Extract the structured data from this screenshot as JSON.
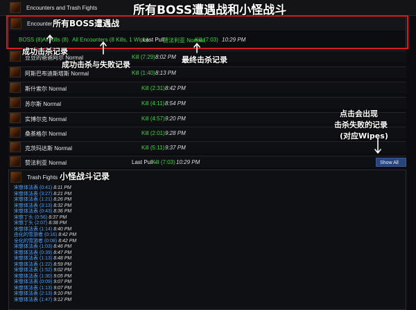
{
  "top": {
    "title": "Encounters and Trash Fights"
  },
  "encounters_panel": {
    "title": "Encounters",
    "filters": {
      "boss_count": "BOSS (8)",
      "all_kills": "All Kills (8)",
      "all_encounters": "All Encounters (8 Kills, 1 Wipe)",
      "last_pull_label": "Last Pull -",
      "last_pull_boss": "赞法利亚 Normal",
      "last_pull_kill": "Kill (7:03)",
      "last_pull_time": "10:29 PM"
    }
  },
  "boss_rows": [
    {
      "name": "豆豆的爸爸阿尔 Normal",
      "kill": "Kill (7:29)",
      "time": "8:02 PM"
    },
    {
      "name": "阿斯巴布迪斯塔斯 Normal",
      "kill": "Kill (1:40)",
      "time": "8:13 PM"
    },
    {
      "name": "斯什索尔 Normal",
      "kill": "Kill (2:31)",
      "time": "8:42 PM"
    },
    {
      "name": "苏尔斯 Normal",
      "kill": "Kill (4:11)",
      "time": "8:54 PM"
    },
    {
      "name": "实博尔克 Normal",
      "kill": "Kill (4:57)",
      "time": "9:20 PM"
    },
    {
      "name": "桑茶格尔 Normal",
      "kill": "Kill (2:01)",
      "time": "9:28 PM"
    },
    {
      "name": "克茨玛达斯 Normal",
      "kill": "Kill (5:11)",
      "time": "9:37 PM"
    },
    {
      "name": "赞法利亚 Normal",
      "last_pull": "Last Pull -",
      "kill": "Kill (7:03)",
      "time": "10:29 PM",
      "button": "Show All ▾"
    }
  ],
  "trash_panel": {
    "title": "Trash Fights",
    "lines": [
      {
        "name": "宋慈体法表 (0:41)",
        "time": "8:11 PM"
      },
      {
        "name": "宋慈体法表 (3:27)",
        "time": "8:21 PM"
      },
      {
        "name": "宋慈体法表 (1:21)",
        "time": "8:26 PM"
      },
      {
        "name": "宋慈体法表 (3:13)",
        "time": "8:32 PM"
      },
      {
        "name": "宋慈体法表 (0:43)",
        "time": "8:36 PM"
      },
      {
        "name": "宋慈丁头 (0:56)",
        "time": "8:37 PM"
      },
      {
        "name": "宋慈丁头 (2:07)",
        "time": "8:38 PM"
      },
      {
        "name": "宋慈体法表 (1:14)",
        "time": "8:40 PM"
      },
      {
        "name": "由化的雪游者 (0:16)",
        "time": "8:42 PM"
      },
      {
        "name": "全化的雪游者 (0:08)",
        "time": "8:42 PM"
      },
      {
        "name": "宋慈体法表 (1:03)",
        "time": "8:46 PM"
      },
      {
        "name": "宋慈体法表 (0:39)",
        "time": "8:47 PM"
      },
      {
        "name": "宋慈体法表 (1:13)",
        "time": "8:48 PM"
      },
      {
        "name": "宋慈体法表 (1:22)",
        "time": "8:59 PM"
      },
      {
        "name": "宋慈体法表 (1:52)",
        "time": "9:02 PM"
      },
      {
        "name": "宋慈体法表 (1:30)",
        "time": "9:05 PM"
      },
      {
        "name": "宋慈体法表 (0:09)",
        "time": "9:07 PM"
      },
      {
        "name": "宋慈体法表 (1:13)",
        "time": "9:07 PM"
      },
      {
        "name": "宋慈体法表 (2:13)",
        "time": "9:10 PM"
      },
      {
        "name": "宋慈体法表 (1:47)",
        "time": "9:12 PM"
      }
    ]
  },
  "annotations": {
    "header": "所有BOSS遭遇战和小怪战斗",
    "boss_encounters": "所有BOSS遭遇战",
    "kill_records": "成功击杀记录",
    "kill_wipe_records": "成功击杀与失败记录",
    "last_kill": "最终击杀记录",
    "show_all_line1": "点击会出现",
    "show_all_line2": "击杀失败的记录",
    "show_all_line3": "(对应Wipes)",
    "trash": "小怪战斗记录"
  }
}
